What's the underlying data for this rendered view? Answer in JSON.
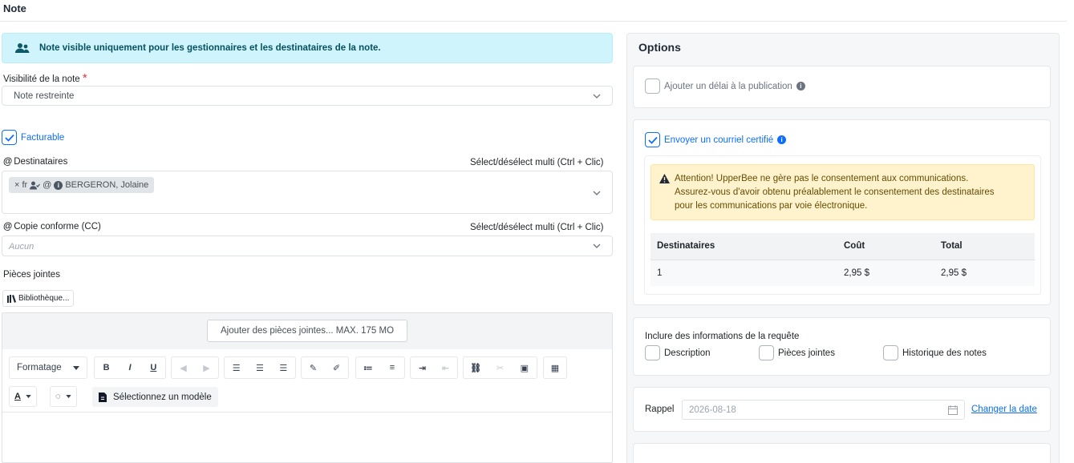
{
  "page_title": "Note",
  "banner": {
    "text": "Note visible uniquement pour les gestionnaires et les destinataires de la note."
  },
  "visibility": {
    "label": "Visibilité de la note",
    "required_mark": "*",
    "value": "Note restreinte"
  },
  "billable": {
    "label": "Facturable",
    "checked": true
  },
  "recipients": {
    "label": "Destinataires",
    "multi_hint": "Sélect/désélect multi (Ctrl + Clic)",
    "tag": {
      "remove": "×",
      "lang": "fr",
      "name": "BERGERON, Jolaine"
    }
  },
  "cc": {
    "label": "Copie conforme (CC)",
    "multi_hint": "Sélect/désélect multi (Ctrl + Clic)",
    "placeholder": "Aucun"
  },
  "attachments": {
    "label": "Pièces jointes",
    "library_button": "Bibliothèque...",
    "add_button": "Ajouter des pièces jointes... MAX. 175 MO"
  },
  "editor": {
    "format_select": "Formatage",
    "bold": "B",
    "italic": "I",
    "underline": "U",
    "template_button": "Sélectionnez un modèle"
  },
  "options": {
    "title": "Options",
    "delay": {
      "label": "Ajouter un délai à la publication",
      "checked": false
    },
    "certified_mail": {
      "label": "Envoyer un courriel certifié",
      "checked": true
    },
    "warning": {
      "lines": [
        "Attention! UpperBee ne gère pas le consentement aux communications.",
        "Assurez-vous d'avoir obtenu préalablement le consentement des destinataires",
        "pour les communications par voie électronique."
      ]
    },
    "cost_table": {
      "headers": [
        "Destinataires",
        "Coût",
        "Total"
      ],
      "rows": [
        [
          "1",
          "2,95 $",
          "2,95 $"
        ]
      ]
    },
    "include_info": {
      "label": "Inclure des informations de la requête",
      "items": [
        {
          "label": "Description",
          "checked": false
        },
        {
          "label": "Pièces jointes",
          "checked": false
        },
        {
          "label": "Historique des notes",
          "checked": false
        }
      ]
    },
    "reminder": {
      "label": "Rappel",
      "date": "2026-08-18",
      "change_link": "Changer la date"
    }
  },
  "colors": {
    "accent": "#0d6efd",
    "info_bg": "#cff4fc",
    "warning_bg": "#fff3cd",
    "required": "#dc3545"
  }
}
